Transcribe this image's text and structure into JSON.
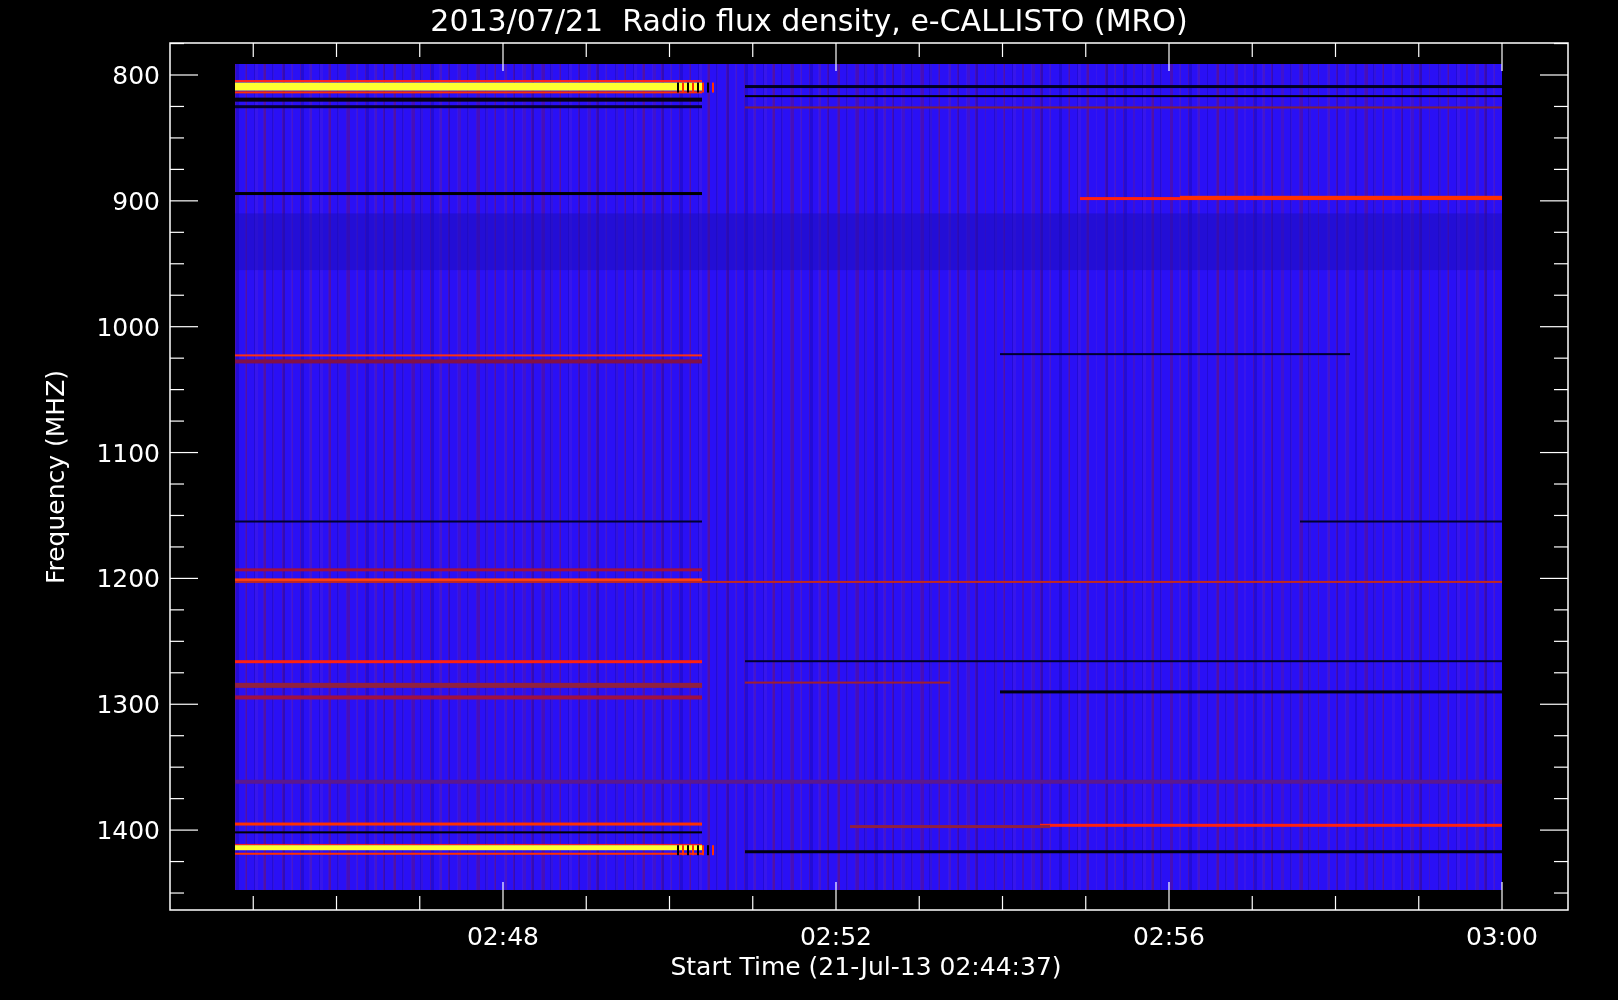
{
  "title": "2013/07/21  Radio flux density, e-CALLISTO (MRO)",
  "plot": {
    "ylabel": "Frequency (MHZ)",
    "xlabel": "Start Time (21-Jul-13 02:44:37)",
    "yticks": [
      "800",
      "900",
      "1000",
      "1100",
      "1200",
      "1300",
      "1400"
    ],
    "xticks": [
      "02:48",
      "02:52",
      "02:56",
      "03:00"
    ]
  }
}
